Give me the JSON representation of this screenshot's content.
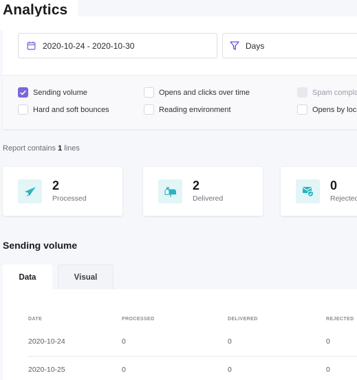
{
  "header": {
    "title": "Analytics"
  },
  "filters": {
    "date_range": "2020-10-24 - 2020-10-30",
    "date_icon": "calendar-icon",
    "grouping": "Days",
    "grouping_icon": "filter-icon"
  },
  "options": [
    {
      "label": "Sending volume",
      "checked": true,
      "disabled": false
    },
    {
      "label": "Hard and soft bounces",
      "checked": false,
      "disabled": false
    },
    {
      "label": "Opens and clicks over time",
      "checked": false,
      "disabled": false
    },
    {
      "label": "Reading environment",
      "checked": false,
      "disabled": false
    },
    {
      "label": "Spam compla",
      "checked": false,
      "disabled": true
    },
    {
      "label": "Opens by loca",
      "checked": false,
      "disabled": false
    }
  ],
  "report": {
    "prefix": "Report contains ",
    "count": "1",
    "suffix": " lines"
  },
  "stats": [
    {
      "value": "2",
      "label": "Processed",
      "icon": "paper-plane-icon"
    },
    {
      "value": "2",
      "label": "Delivered",
      "icon": "mailbox-icon"
    },
    {
      "value": "0",
      "label": "Rejected",
      "icon": "shielded-mail-icon"
    }
  ],
  "colors": {
    "accent": "#7b68d8",
    "teal": "#2ab3c0",
    "tile_bg": "#e2f5f7"
  },
  "section": {
    "title": "Sending volume",
    "tabs": [
      {
        "label": "Data",
        "active": true
      },
      {
        "label": "Visual",
        "active": false
      }
    ]
  },
  "table": {
    "columns": [
      "DATE",
      "PROCESSED",
      "DELIVERED",
      "REJECTED"
    ],
    "rows": [
      [
        "2020-10-24",
        "0",
        "0",
        "0"
      ],
      [
        "2020-10-25",
        "0",
        "0",
        "0"
      ]
    ]
  }
}
